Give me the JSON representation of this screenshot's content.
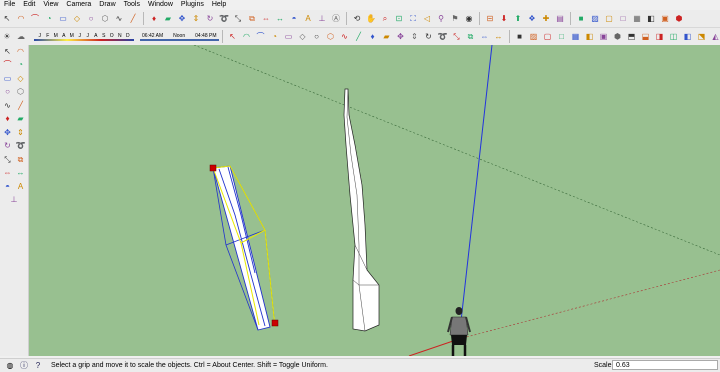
{
  "menu": [
    "File",
    "Edit",
    "View",
    "Camera",
    "Draw",
    "Tools",
    "Window",
    "Plugins",
    "Help"
  ],
  "toolbar_row1": {
    "icons": [
      "arrow",
      "arc",
      "arc-2point",
      "pie",
      "rectangle",
      "rotated-rect",
      "circle",
      "polygon",
      "freehand",
      "line",
      "paint",
      "eraser",
      "move",
      "push-pull",
      "rotate",
      "follow-me",
      "scale",
      "offset",
      "tape",
      "dimension",
      "protractor",
      "text",
      "axes",
      "3d-text",
      "orbit",
      "pan",
      "zoom",
      "zoom-window",
      "zoom-extents",
      "previous",
      "position-camera",
      "walk",
      "look-around",
      "section",
      "3dw-get",
      "3dw-share",
      "component",
      "extension",
      "layout"
    ],
    "view_icons": [
      "shaded",
      "xray",
      "wire",
      "hidden",
      "shaded-tex",
      "mono",
      "back-edges",
      "iso",
      "top",
      "front",
      "right",
      "back",
      "left",
      "bottom",
      "perspective",
      "two-point",
      "parallel"
    ]
  },
  "toolbar_row2": {
    "shadow_months": [
      "J",
      "F",
      "M",
      "A",
      "M",
      "J",
      "J",
      "A",
      "S",
      "O",
      "N",
      "D"
    ],
    "time_start": "06:42 AM",
    "time_noon": "Noon",
    "time_end": "04:48 PM"
  },
  "status": {
    "message": "Select a grip and move it to scale the objects. Ctrl = About Center. Shift = Toggle Uniform.",
    "measure_label": "Scale",
    "measure_value": "0.63"
  },
  "colors": {
    "viewport_bg": "#98c090",
    "blue_axis": "#2233dd",
    "red_axis": "#cc2222",
    "green_axis": "#3a7a3a",
    "selection_yellow": "#e8e800",
    "grip_red": "#cc0000"
  }
}
